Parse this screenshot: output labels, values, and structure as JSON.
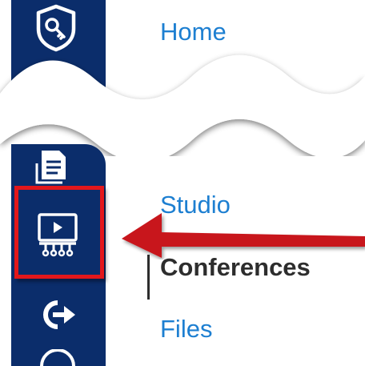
{
  "nav": {
    "home_label": "Home",
    "studio_label": "Studio",
    "conferences_label": "Conferences",
    "files_label": "Files"
  },
  "icons": {
    "admin": "shield-key-icon",
    "assignments": "assignments-icon",
    "studio": "studio-video-icon",
    "logout": "logout-icon",
    "help": "help-icon"
  },
  "colors": {
    "sidebar": "#0b2d6b",
    "link": "#1d7fd1",
    "current_text": "#2d2d2d",
    "highlight": "#e3171b",
    "arrow": "#c8161d"
  }
}
